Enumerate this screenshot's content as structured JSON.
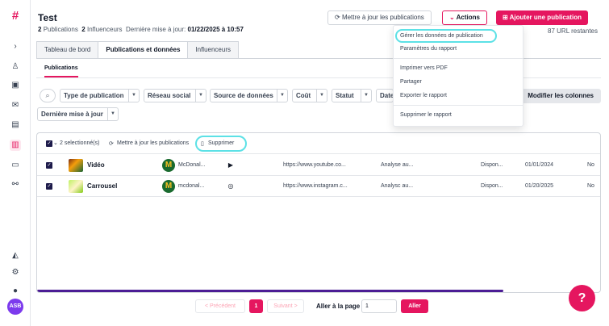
{
  "sidebar": {
    "logo": "#",
    "avatar_initials": "ASB",
    "icons": [
      "chevron-right-icon",
      "user-plus-icon",
      "contact-card-icon",
      "mail-icon",
      "calendar-icon",
      "bar-chart-icon",
      "wallet-icon",
      "share-nodes-icon",
      "megaphone-icon",
      "settings-icon",
      "user-icon"
    ]
  },
  "header": {
    "title": "Test",
    "publications_count": "2",
    "publications_label": "Publications",
    "influencers_count": "2",
    "influencers_label": "Influenceurs",
    "last_update_label": "Dernière mise à jour:",
    "last_update_value": "01/22/2025 à 10:57",
    "update_button": "Mettre à jour les publications",
    "actions_button": "Actions",
    "add_button": "Ajouter une publication",
    "url_remaining": "87 URL restantes"
  },
  "tabs": [
    {
      "label": "Tableau de bord"
    },
    {
      "label": "Publications et données"
    },
    {
      "label": "Influenceurs"
    }
  ],
  "subtab": "Publications",
  "filters": {
    "type": "Type de publication",
    "network": "Réseau social",
    "source": "Source de données",
    "cost": "Coût",
    "status": "Statut",
    "date": "Date",
    "last_update": "Dernière mise à jour",
    "modify_columns": "Modifier les colonnes"
  },
  "toolbar": {
    "selected": "2 selectionné(s)",
    "update": "Mettre à jour les publications",
    "delete": "Supprimer"
  },
  "rows": [
    {
      "name": "Vidéo",
      "influencer": "McDonal...",
      "network_icon": "youtube-icon",
      "url": "https://www.youtube.co...",
      "analysis": "Analyse au...",
      "status": "Dispon...",
      "date": "01/01/2024",
      "extra": "No"
    },
    {
      "name": "Carrousel",
      "influencer": "mcdonal...",
      "network_icon": "instagram-icon",
      "url": "https://www.instagram.c...",
      "analysis": "Analysc au...",
      "status": "Dispon...",
      "date": "01/20/2025",
      "extra": "No"
    }
  ],
  "pagination": {
    "prev": "< Précédent",
    "page": "1",
    "next": "Suivant >",
    "goto_label": "Aller à la page",
    "goto_value": "1",
    "go_button": "Aller"
  },
  "actions_menu": {
    "items": [
      "Gérer les données de publication",
      "Paramètres du rapport",
      "Imprimer vers PDF",
      "Partager",
      "Exporter le rapport",
      "Supprimer le rapport"
    ]
  },
  "colors": {
    "brand": "#e5165f",
    "highlight": "#5ce1e6"
  }
}
